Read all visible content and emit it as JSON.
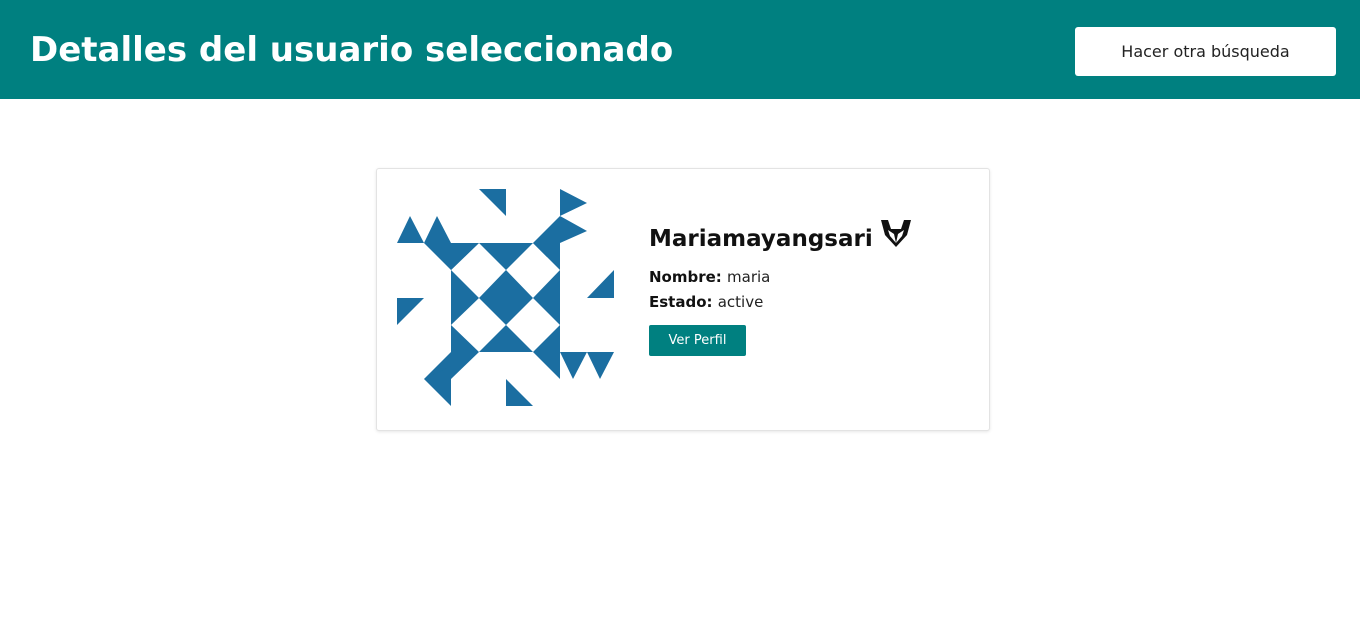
{
  "header": {
    "title": "Detalles del usuario seleccionado",
    "search_again_label": "Hacer otra búsqueda"
  },
  "user": {
    "username": "Mariamayangsari",
    "name_label": "Nombre:",
    "name_value": "maria",
    "status_label": "Estado:",
    "status_value": "active",
    "profile_button_label": "Ver Perfil",
    "platform_icon": "gitlab-icon",
    "avatar": "identicon"
  },
  "colors": {
    "header_bg": "#008080",
    "identicon": "#1b6ea1",
    "button_bg": "#008080"
  }
}
